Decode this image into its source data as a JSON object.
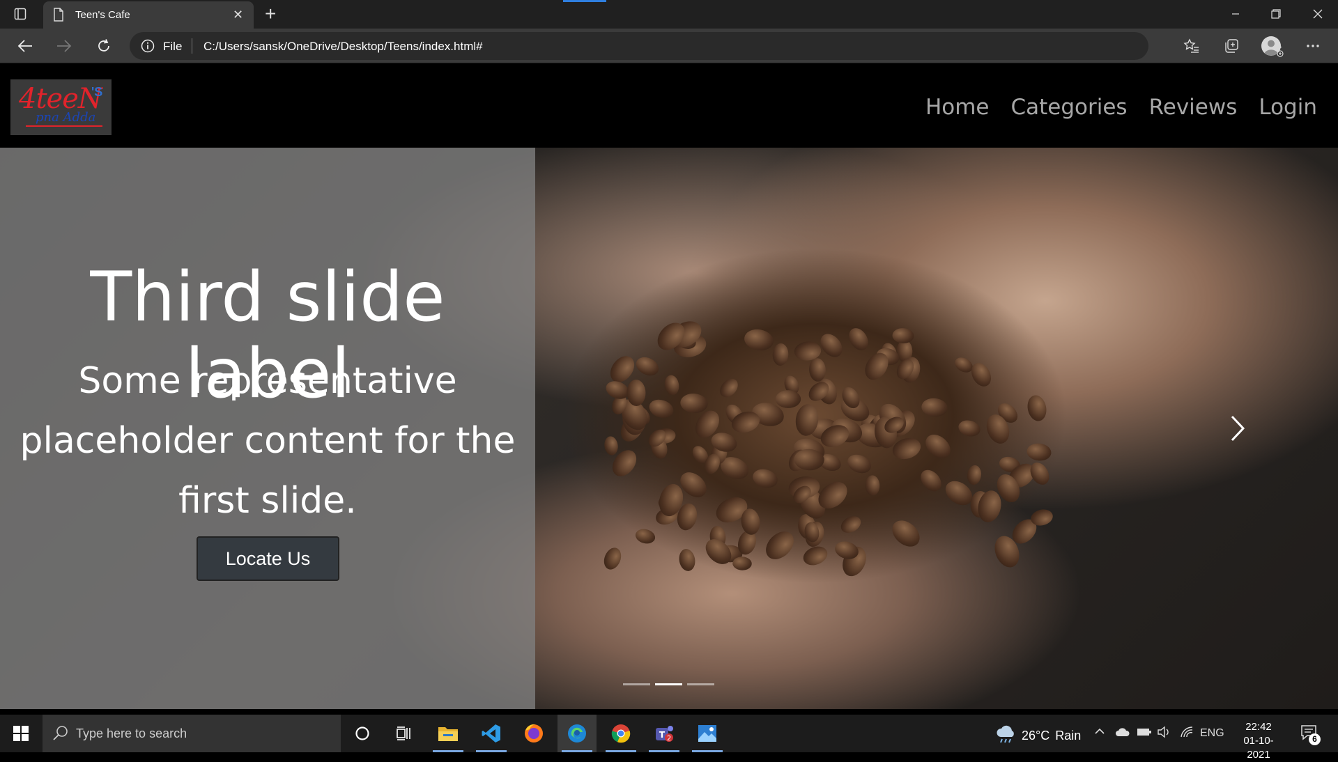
{
  "browser": {
    "tab": {
      "title": "Teen's Cafe"
    },
    "address": {
      "scheme_label": "File",
      "url": "C:/Users/sansk/OneDrive/Desktop/Teens/index.html#"
    }
  },
  "site": {
    "logo": {
      "main": "4teeN",
      "sup": "'S",
      "sub": "pna Adda"
    },
    "nav": [
      "Home",
      "Categories",
      "Reviews",
      "Login"
    ],
    "carousel": {
      "title": "Third slide label",
      "text": "Some representative placeholder content for the first slide.",
      "button": "Locate Us",
      "indicator_count": 3,
      "active_index": 1
    }
  },
  "taskbar": {
    "search_placeholder": "Type here to search",
    "weather": {
      "temp": "26°C",
      "condition": "Rain"
    },
    "language": "ENG",
    "time": "22:42",
    "date": "01-10-2021",
    "notifications": "6"
  },
  "colors": {
    "accent": "#2f7fe0",
    "logo_red": "#e1232b",
    "button": "#343a40"
  }
}
